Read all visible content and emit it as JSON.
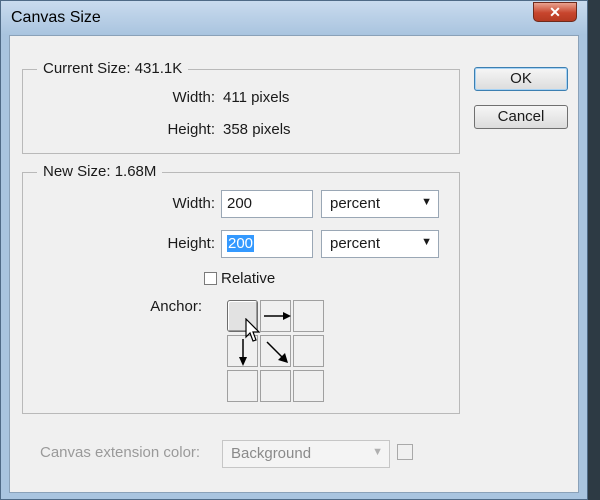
{
  "window": {
    "title": "Canvas Size",
    "close_glyph": "✕"
  },
  "current_size": {
    "legend": "Current Size: 431.1K",
    "width_label": "Width:",
    "width_value": "411 pixels",
    "height_label": "Height:",
    "height_value": "358 pixels"
  },
  "new_size": {
    "legend": "New Size: 1.68M",
    "width_label": "Width:",
    "width_value": "200",
    "width_unit": "percent",
    "height_label": "Height:",
    "height_value": "200",
    "height_unit": "percent",
    "relative_label": "Relative",
    "relative_checked": false,
    "anchor_label": "Anchor:"
  },
  "buttons": {
    "ok": "OK",
    "cancel": "Cancel"
  },
  "extension": {
    "label": "Canvas extension color:",
    "value": "Background"
  },
  "icons": {
    "close": "close-icon",
    "dropdown": "chevron-down-icon",
    "arrow_right": "arrow-right-icon",
    "arrow_down": "arrow-down-icon",
    "arrow_down_right": "arrow-down-right-icon",
    "cursor": "mouse-pointer-icon"
  },
  "colors": {
    "selection": "#3399ff",
    "title_bar": "#a9c4df",
    "close_button": "#c7452d"
  }
}
